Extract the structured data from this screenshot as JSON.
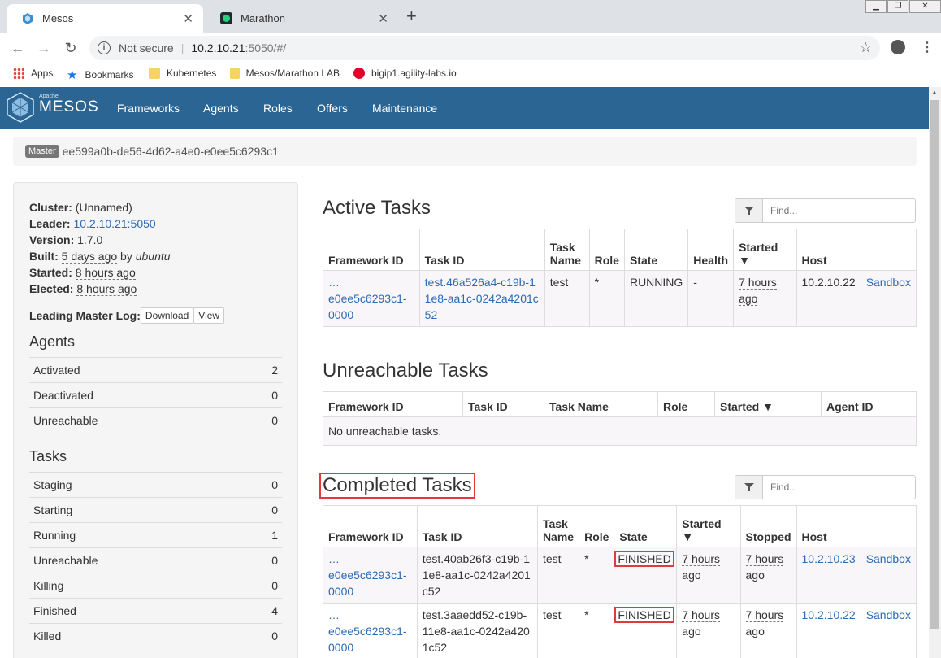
{
  "browser": {
    "tabs": [
      {
        "title": "Mesos",
        "icon": "mesos-favicon"
      },
      {
        "title": "Marathon",
        "icon": "marathon-favicon"
      }
    ],
    "new_tab": "+",
    "address": {
      "security": "Not secure",
      "host": "10.2.10.21",
      "rest": ":5050/#/"
    },
    "bookmarks": [
      "Apps",
      "Bookmarks",
      "Kubernetes",
      "Mesos/Marathon LAB",
      "bigip1.agility-labs.io"
    ]
  },
  "nav": {
    "logo_small": "Apache",
    "logo": "MESOS",
    "links": [
      "Frameworks",
      "Agents",
      "Roles",
      "Offers",
      "Maintenance"
    ]
  },
  "master": {
    "label": "Master",
    "id": "ee599a0b-de56-4d62-a4e0-e0ee5c6293c1"
  },
  "sidebar": {
    "cluster_label": "Cluster:",
    "cluster": "(Unnamed)",
    "leader_label": "Leader:",
    "leader": "10.2.10.21:5050",
    "version_label": "Version:",
    "version": "1.7.0",
    "built_label": "Built:",
    "built": "5 days ago",
    "built_by": "by",
    "built_user": "ubuntu",
    "started_label": "Started:",
    "started": "8 hours ago",
    "elected_label": "Elected:",
    "elected": "8 hours ago",
    "log_label": "Leading Master Log:",
    "download": "Download",
    "view": "View",
    "agents_title": "Agents",
    "agents": [
      {
        "label": "Activated",
        "value": "2"
      },
      {
        "label": "Deactivated",
        "value": "0"
      },
      {
        "label": "Unreachable",
        "value": "0"
      }
    ],
    "tasks_title": "Tasks",
    "tasks": [
      {
        "label": "Staging",
        "value": "0"
      },
      {
        "label": "Starting",
        "value": "0"
      },
      {
        "label": "Running",
        "value": "1"
      },
      {
        "label": "Unreachable",
        "value": "0"
      },
      {
        "label": "Killing",
        "value": "0"
      },
      {
        "label": "Finished",
        "value": "4"
      },
      {
        "label": "Killed",
        "value": "0"
      }
    ]
  },
  "active": {
    "title": "Active Tasks",
    "find_placeholder": "Find...",
    "headers": [
      "Framework ID",
      "Task ID",
      "Task Name",
      "Role",
      "State",
      "Health",
      "Started ▼",
      "Host",
      ""
    ],
    "rows": [
      {
        "fw_prefix": "…",
        "fw": "e0ee5c6293c1-0000",
        "task": "test.46a526a4-c19b-11e8-aa1c-0242a4201c52",
        "name": "test",
        "role": "*",
        "state": "RUNNING",
        "health": "-",
        "started": "7 hours ago",
        "host": "10.2.10.22",
        "sandbox": "Sandbox"
      }
    ]
  },
  "unreachable": {
    "title": "Unreachable Tasks",
    "headers": [
      "Framework ID",
      "Task ID",
      "Task Name",
      "Role",
      "Started ▼",
      "Agent ID"
    ],
    "empty": "No unreachable tasks."
  },
  "completed": {
    "title": "Completed Tasks",
    "find_placeholder": "Find...",
    "headers": [
      "Framework ID",
      "Task ID",
      "Task Name",
      "Role",
      "State",
      "Started ▼",
      "Stopped",
      "Host",
      ""
    ],
    "rows": [
      {
        "fw_prefix": "…",
        "fw": "e0ee5c6293c1-0000",
        "task": "test.40ab26f3-c19b-11e8-aa1c-0242a4201c52",
        "name": "test",
        "role": "*",
        "state": "FINISHED",
        "started": "7 hours ago",
        "stopped": "7 hours ago",
        "host": "10.2.10.23",
        "sandbox": "Sandbox"
      },
      {
        "fw_prefix": "…",
        "fw": "e0ee5c6293c1-0000",
        "task": "test.3aaedd52-c19b-11e8-aa1c-0242a4201c52",
        "name": "test",
        "role": "*",
        "state": "FINISHED",
        "started": "7 hours ago",
        "stopped": "7 hours ago",
        "host": "10.2.10.22",
        "sandbox": "Sandbox"
      }
    ]
  },
  "colors": {
    "navbar": "#2b6593",
    "link": "#2b6bb3",
    "highlight": "#e23a3a"
  }
}
